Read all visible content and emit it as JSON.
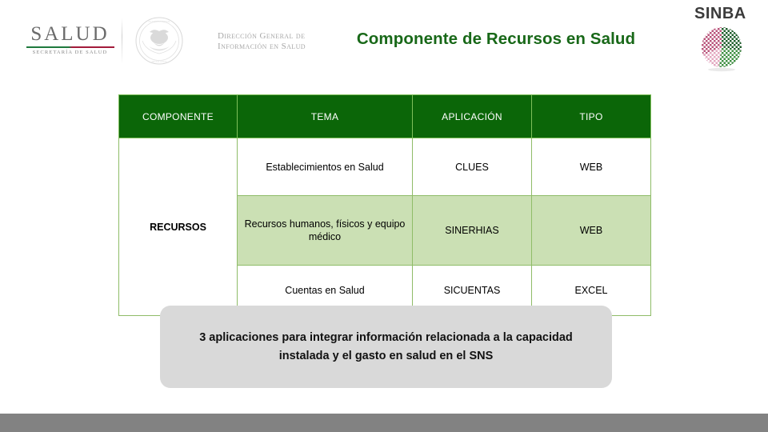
{
  "header": {
    "salud_logo": {
      "word": "SALUD",
      "subtitle": "SECRETARÍA DE SALUD",
      "green": "#1f7a3d",
      "red": "#a31b3b"
    },
    "coat_of_arms_name": "mexico-coat-of-arms",
    "dgis_line1": "Dirección General de",
    "dgis_line2": "Información en Salud",
    "title": "Componente de Recursos en Salud",
    "title_color": "#186818",
    "sinba_logo": {
      "word": "SINBA",
      "globe_green": "#3f8f43",
      "globe_pink": "#b8537a"
    }
  },
  "table": {
    "header_bg": "#0b6608",
    "border_color": "#8fbc68",
    "row_green_bg": "#cbe0b4",
    "columns": [
      "COMPONENTE",
      "TEMA",
      "APLICACIÓN",
      "TIPO"
    ],
    "component_label": "RECURSOS",
    "rows": [
      {
        "tema": "Establecimientos en Salud",
        "aplicacion": "CLUES",
        "tipo": "WEB",
        "shade": "white"
      },
      {
        "tema": "Recursos humanos, físicos y equipo médico",
        "aplicacion": "SINERHIAS",
        "tipo": "WEB",
        "shade": "green"
      },
      {
        "tema": "Cuentas en Salud",
        "aplicacion": "SICUENTAS",
        "tipo": "EXCEL",
        "shade": "white"
      }
    ]
  },
  "callout": {
    "text": "3 aplicaciones para integrar información relacionada a la capacidad instalada y el gasto en salud en el SNS",
    "background": "#d9d9d9"
  },
  "footer": {
    "color": "#828282"
  }
}
